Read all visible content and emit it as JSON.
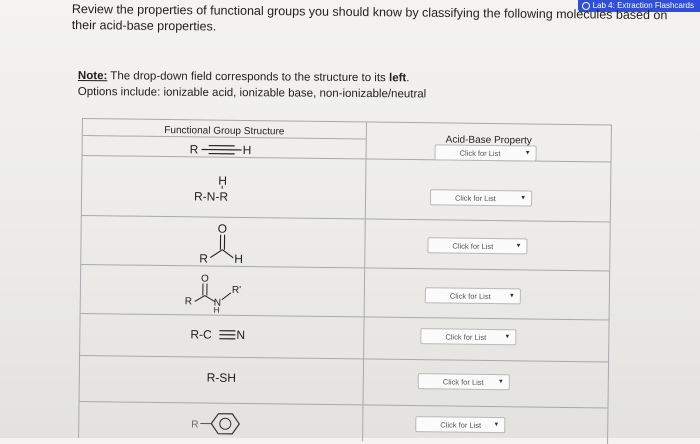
{
  "header": {
    "badge_label": "Lab 4: Extraction Flashcards"
  },
  "instructions": {
    "line1": "Review the properties of functional groups you should know by classifying the following molecules based on",
    "line2": "their acid-base properties.",
    "note_label": "Note:",
    "note_text_pre": " The drop-down field corresponds to the structure to its ",
    "note_text_bold": "left",
    "note_text_post": ".",
    "options_text": "Options include: ionizable acid, ionizable base, non-ionizable/neutral"
  },
  "table": {
    "col1_header": "Functional Group Structure",
    "col2_header": "Acid-Base Property",
    "dropdown_placeholder": "Click for List",
    "rows": [
      {
        "id": "alkyne",
        "labels": [
          "R",
          "H"
        ]
      },
      {
        "id": "amine",
        "labels": [
          "H",
          "R-N-R"
        ]
      },
      {
        "id": "aldehyde",
        "labels": [
          "O",
          "R",
          "H"
        ]
      },
      {
        "id": "amide",
        "labels": [
          "O",
          "R",
          "N",
          "H",
          "R'"
        ]
      },
      {
        "id": "nitrile",
        "labels": [
          "R-C",
          "N"
        ]
      },
      {
        "id": "thiol",
        "labels": [
          "R-SH"
        ]
      },
      {
        "id": "benzene",
        "labels": [
          "R"
        ]
      }
    ]
  }
}
